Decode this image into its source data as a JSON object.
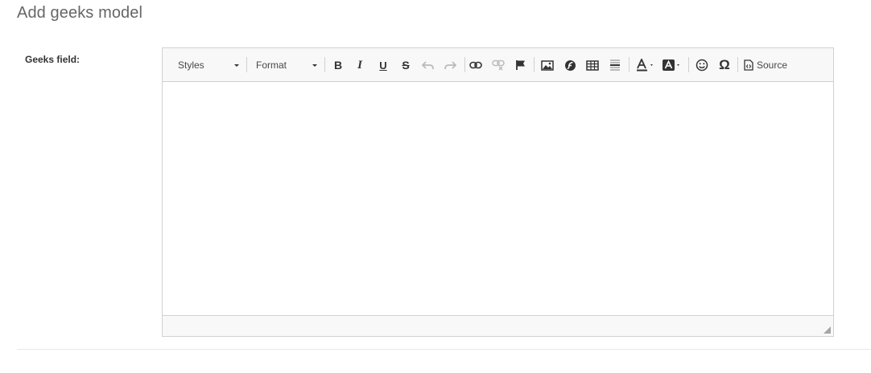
{
  "page": {
    "title": "Add geeks model"
  },
  "form": {
    "field_label": "Geeks field:"
  },
  "editor": {
    "styles_label": "Styles",
    "format_label": "Format",
    "bold": "B",
    "italic": "I",
    "underline": "U",
    "strike": "S",
    "special_char": "Ω",
    "source_label": "Source",
    "content": ""
  }
}
